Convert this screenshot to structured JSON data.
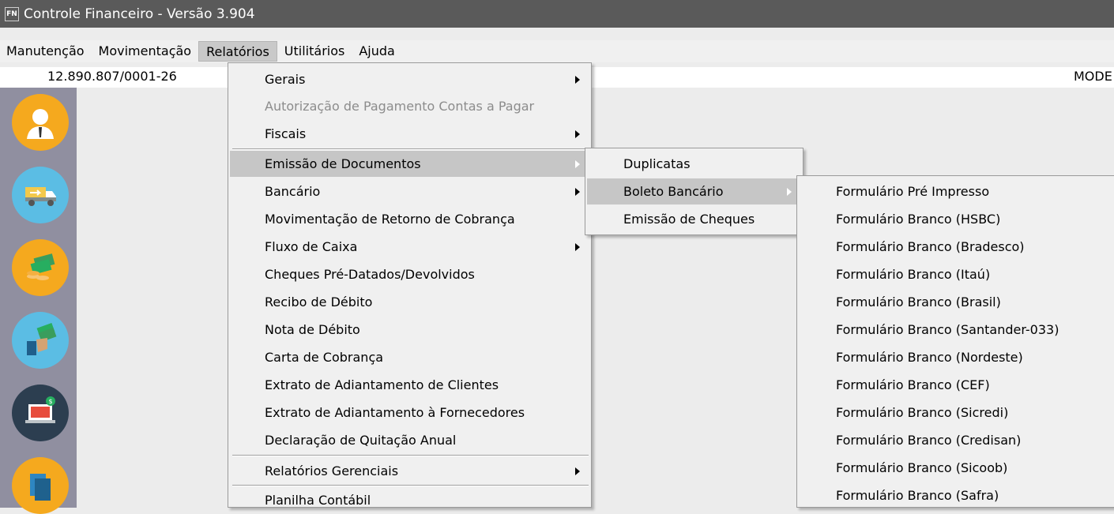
{
  "window": {
    "app_icon_text": "FN",
    "title": "Controle Financeiro - Versão 3.904"
  },
  "menubar": {
    "items": [
      "Manutenção",
      "Movimentação",
      "Relatórios",
      "Utilitários",
      "Ajuda"
    ],
    "active": "Relatórios"
  },
  "infobar": {
    "cnpj": "12.890.807/0001-26",
    "mode": "MODE"
  },
  "sidebar": {
    "icons": [
      "user-icon",
      "truck-icon",
      "money-coins-icon",
      "hand-money-icon",
      "laptop-dollar-icon",
      "documents-icon"
    ]
  },
  "relatorios_menu": {
    "items": [
      {
        "label": "Gerais",
        "submenu": true
      },
      {
        "label": "Autorização de Pagamento Contas a Pagar",
        "disabled": true
      },
      {
        "label": "Fiscais",
        "submenu": true
      },
      {
        "label": "Emissão de Documentos",
        "submenu": true,
        "highlighted": true
      },
      {
        "label": "Bancário",
        "submenu": true
      },
      {
        "label": "Movimentação de Retorno de Cobrança"
      },
      {
        "label": "Fluxo de Caixa",
        "submenu": true
      },
      {
        "label": "Cheques Pré-Datados/Devolvidos"
      },
      {
        "label": "Recibo de Débito"
      },
      {
        "label": "Nota de Débito"
      },
      {
        "label": "Carta de Cobrança"
      },
      {
        "label": "Extrato de Adiantamento de Clientes"
      },
      {
        "label": "Extrato de Adiantamento à Fornecedores"
      },
      {
        "label": "Declaração de Quitação Anual"
      },
      {
        "label": "Relatórios Gerenciais",
        "submenu": true
      },
      {
        "label": "Planilha Contábil"
      }
    ]
  },
  "emissao_menu": {
    "items": [
      {
        "label": "Duplicatas"
      },
      {
        "label": "Boleto Bancário",
        "submenu": true,
        "highlighted": true
      },
      {
        "label": "Emissão de Cheques"
      }
    ]
  },
  "boleto_menu": {
    "items": [
      "Formulário Pré Impresso",
      "Formulário Branco (HSBC)",
      "Formulário Branco (Bradesco)",
      "Formulário Branco (Itaú)",
      "Formulário Branco (Brasil)",
      "Formulário Branco (Santander-033)",
      "Formulário Branco (Nordeste)",
      "Formulário Branco (CEF)",
      "Formulário Branco (Sicredi)",
      "Formulário Branco (Credisan)",
      "Formulário Branco (Sicoob)",
      "Formulário Branco (Safra)"
    ]
  }
}
